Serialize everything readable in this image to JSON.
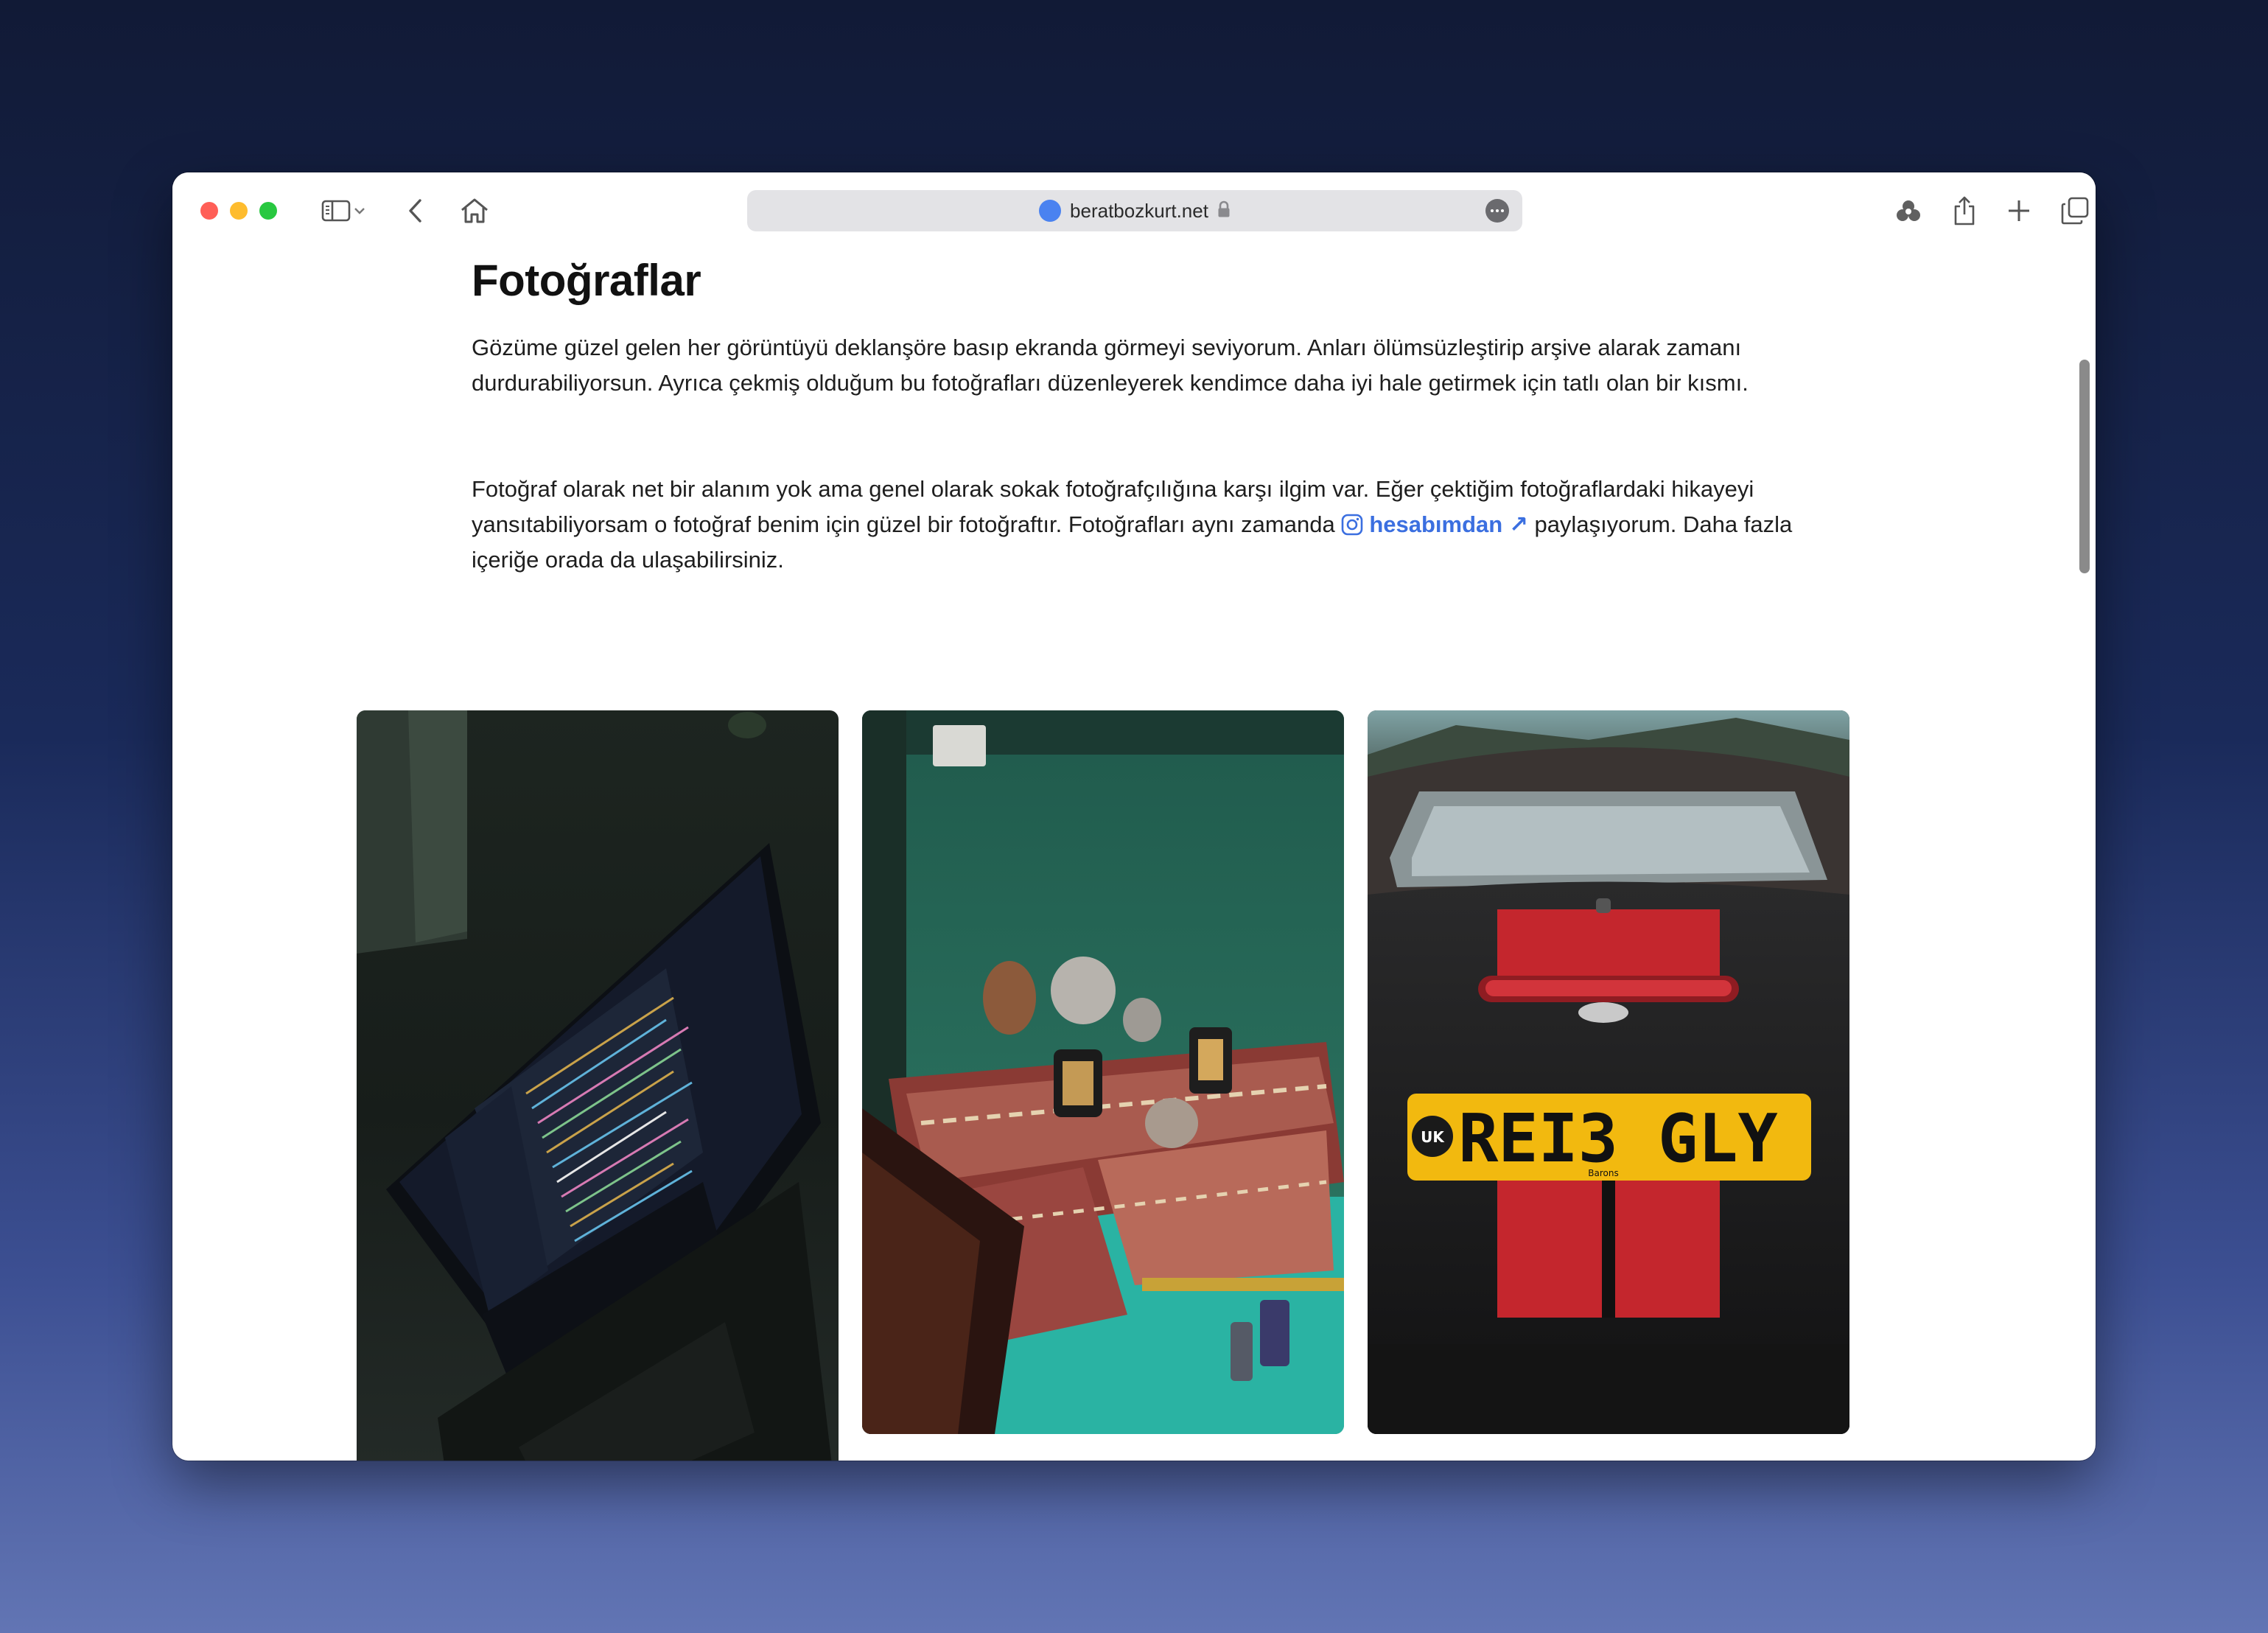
{
  "browser": {
    "url": "beratbozkurt.net",
    "icons": [
      "sidebar-icon",
      "chevron-down-icon",
      "back-icon",
      "home-icon",
      "lock-icon",
      "more-icon",
      "shield-icon",
      "share-icon",
      "plus-icon",
      "tabs-icon"
    ]
  },
  "page": {
    "title": "Fotoğraflar",
    "paragraph1": "Gözüme güzel gelen her görüntüyü deklanşöre basıp ekranda görmeyi seviyorum. Anları ölümsüzleştirip arşive alarak zamanı durdurabiliyorsun. Ayrıca çekmiş olduğum bu fotoğrafları düzenleyerek kendimce daha iyi hale getirmek için tatlı olan bir kısmı.",
    "paragraph2_before": "Fotoğraf olarak net bir alanım yok ama genel olarak sokak fotoğrafçılığına karşı ilgim var. Eğer çektiğim fotoğraflardaki hikayeyi yansıtabiliyorsam o fotoğraf benim için güzel bir fotoğraftır. Fotoğrafları aynı zamanda",
    "link_label": "hesabımdan",
    "link_arrow": "↗",
    "paragraph2_after": "paylaşıyorum. Daha fazla içeriğe orada da ulaşabilirsiniz."
  },
  "photos": {
    "plate_text": "REI3 GLY",
    "plate_country": "UK",
    "plate_dealer": "Barons"
  },
  "colors": {
    "link": "#3b6fe0",
    "favicon": "#4a82f0",
    "plate": "#f2b90f",
    "stripe": "#c4262d"
  }
}
